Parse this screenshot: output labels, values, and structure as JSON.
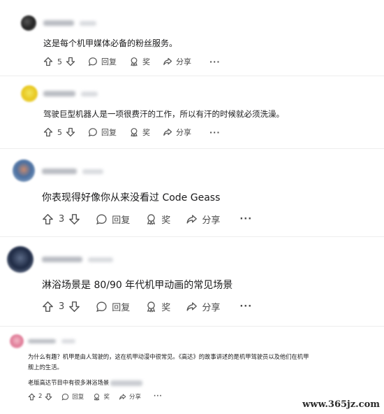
{
  "comments": [
    {
      "text": "这是每个机甲媒体必备的粉丝服务。",
      "votes": "5",
      "reply": "回复",
      "award": "奖",
      "share": "分享",
      "more": "···"
    },
    {
      "text": "驾驶巨型机器人是一项很费汗的工作，所以有汗的时候就必须洗澡。",
      "votes": "5",
      "reply": "回复",
      "award": "奖",
      "share": "分享",
      "more": "···"
    },
    {
      "text": "你表现得好像你从来没看过 Code Geass",
      "votes": "3",
      "reply": "回复",
      "award": "奖",
      "share": "分享",
      "more": "···"
    },
    {
      "text": "淋浴场景是 80/90 年代机甲动画的常见场景",
      "votes": "3",
      "reply": "回复",
      "award": "奖",
      "share": "分享",
      "more": "···"
    },
    {
      "text_line1": "为什么有趣？机甲是由人驾驶的，这在机甲动漫中很常见。《高达》的故事讲述的是机甲驾驶员以及他们在机甲",
      "text_line2": "舰上的生活。",
      "text_line3": "老版高达节目中有很多淋浴场景",
      "votes": "2",
      "reply": "回复",
      "award": "奖",
      "share": "分享",
      "more": "···"
    }
  ],
  "watermark": "www.365jz.com"
}
